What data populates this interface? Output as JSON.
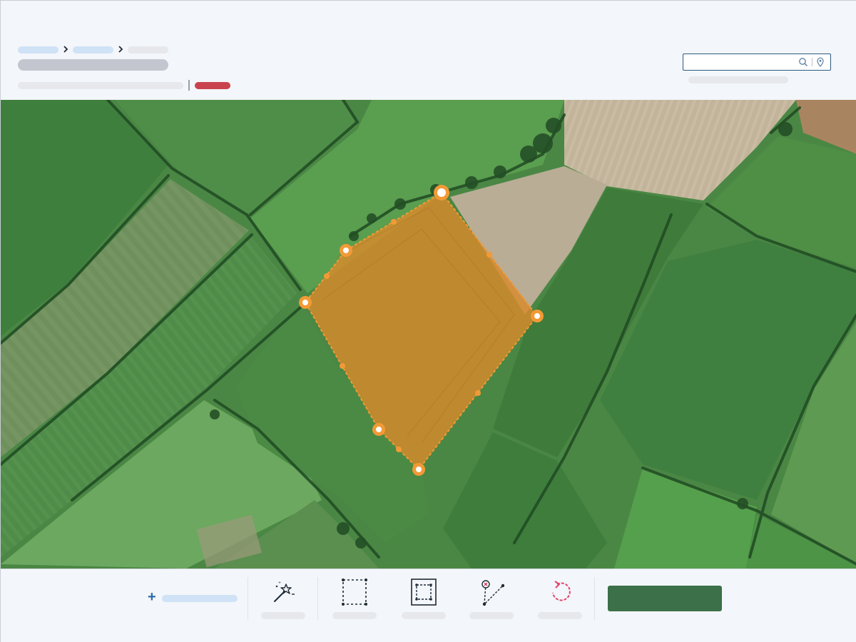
{
  "app": {
    "accent": "#2b6aa8",
    "status_color": "#c9434f",
    "action_color": "#3c7048",
    "selection_color": "#e8952f"
  },
  "header": {
    "breadcrumb": [
      {
        "type": "link",
        "icon": "chevron-right-icon"
      },
      {
        "type": "link",
        "icon": "chevron-right-icon"
      },
      {
        "type": "current"
      }
    ]
  },
  "search": {
    "value": "",
    "placeholder": "",
    "icons": [
      "search-icon",
      "location-pin-icon"
    ]
  },
  "map": {
    "layer": "satellite",
    "boundary": {
      "vertex_count": 7,
      "midpoint_count": 7
    }
  },
  "toolbar": {
    "add_icon": "plus-icon",
    "tools": [
      {
        "icon": "magic-wand-icon"
      },
      {
        "icon": "select-rectangle-icon"
      },
      {
        "icon": "bounding-box-icon"
      },
      {
        "icon": "delete-vertex-icon"
      },
      {
        "icon": "reset-icon"
      }
    ],
    "save_label": ""
  }
}
